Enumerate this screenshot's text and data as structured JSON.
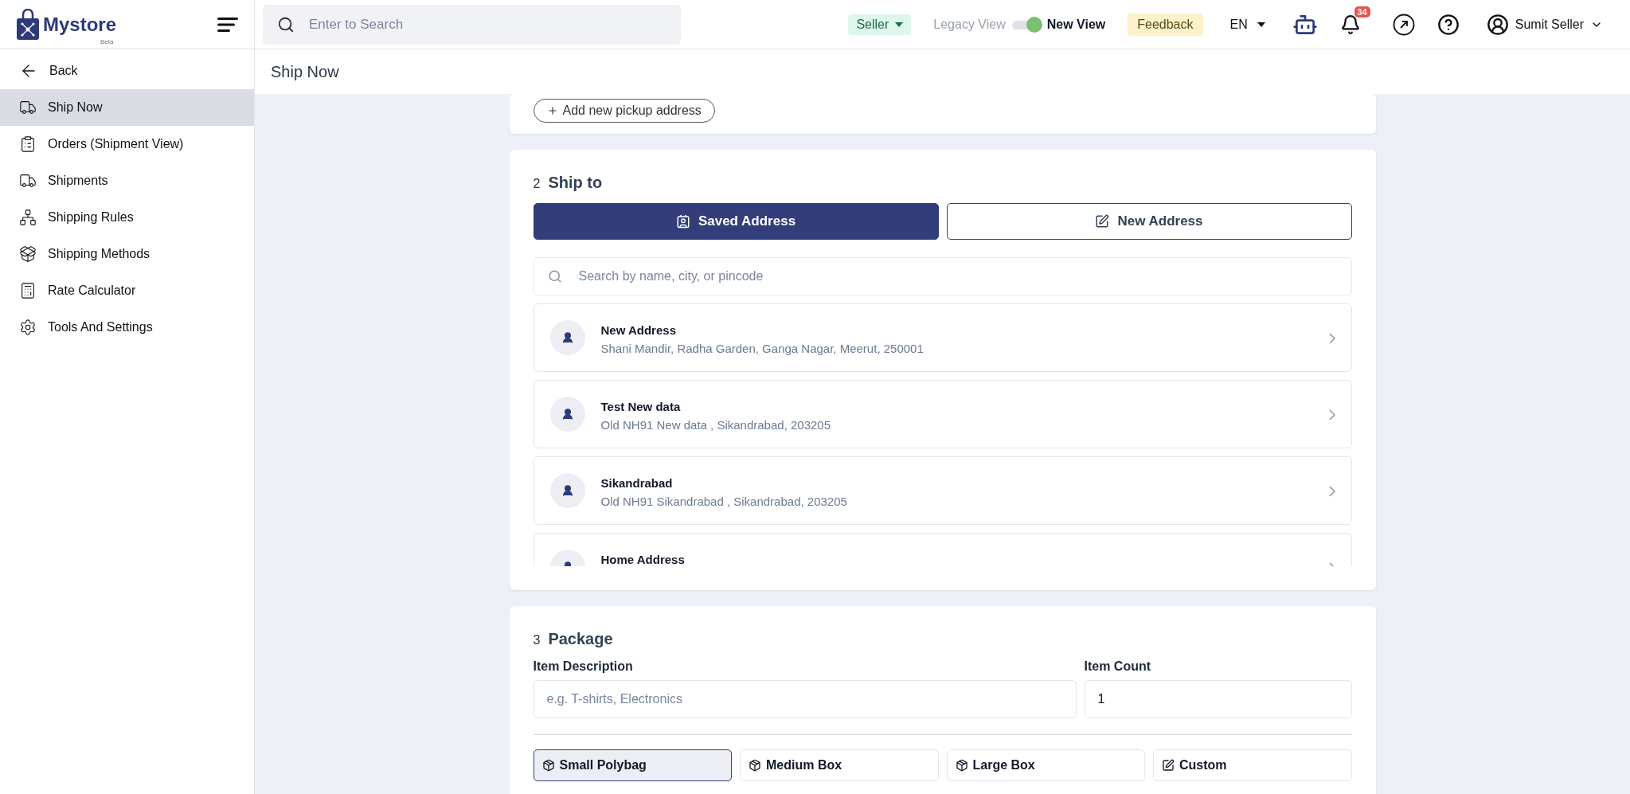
{
  "header": {
    "logo": {
      "name": "Mystore",
      "tag": "Beta"
    },
    "search": {
      "placeholder": "Enter to Search"
    },
    "role": "Seller",
    "view_toggle": {
      "off_label": "Legacy View",
      "on_label": "New View",
      "on": true
    },
    "feedback": "Feedback",
    "language": "EN",
    "notifications": "34",
    "user": "Sumit Seller"
  },
  "sidebar": {
    "back": "Back",
    "items": [
      {
        "label": "Ship Now",
        "selected": true
      },
      {
        "label": "Orders (Shipment View)",
        "selected": false
      },
      {
        "label": "Shipments",
        "selected": false
      },
      {
        "label": "Shipping Rules",
        "selected": false
      },
      {
        "label": "Shipping Methods",
        "selected": false
      },
      {
        "label": "Rate Calculator",
        "selected": false
      },
      {
        "label": "Tools And Settings",
        "selected": false
      }
    ]
  },
  "page_title": "Ship Now",
  "pickup": {
    "add_button": "Add new pickup address"
  },
  "ship_to": {
    "number": "2",
    "title": "Ship to",
    "tabs": [
      {
        "label": "Saved Address",
        "selected": true
      },
      {
        "label": "New Address",
        "selected": false
      }
    ],
    "search": {
      "placeholder": "Search by name, city, or pincode"
    },
    "addresses": [
      {
        "name": "New Address",
        "address": "Shani Mandir, Radha Garden, Ganga Nagar, Meerut, 250001"
      },
      {
        "name": "Test New data",
        "address": "Old NH91 New data , Sikandrabad, 203205"
      },
      {
        "name": "Sikandrabad",
        "address": "Old NH91 Sikandrabad , Sikandrabad, 203205"
      },
      {
        "name": "Home Address"
      }
    ]
  },
  "package": {
    "number": "3",
    "title": "Package",
    "description": {
      "label": "Item Description",
      "placeholder": "e.g. T-shirts, Electronics"
    },
    "count": {
      "label": "Item Count",
      "value": "1"
    },
    "options": [
      {
        "label": "Small Polybag",
        "kind": "preset",
        "selected": true
      },
      {
        "label": "Medium Box",
        "kind": "preset",
        "selected": false
      },
      {
        "label": "Large Box",
        "kind": "preset",
        "selected": false
      },
      {
        "label": "Custom",
        "kind": "custom",
        "selected": false
      }
    ]
  }
}
